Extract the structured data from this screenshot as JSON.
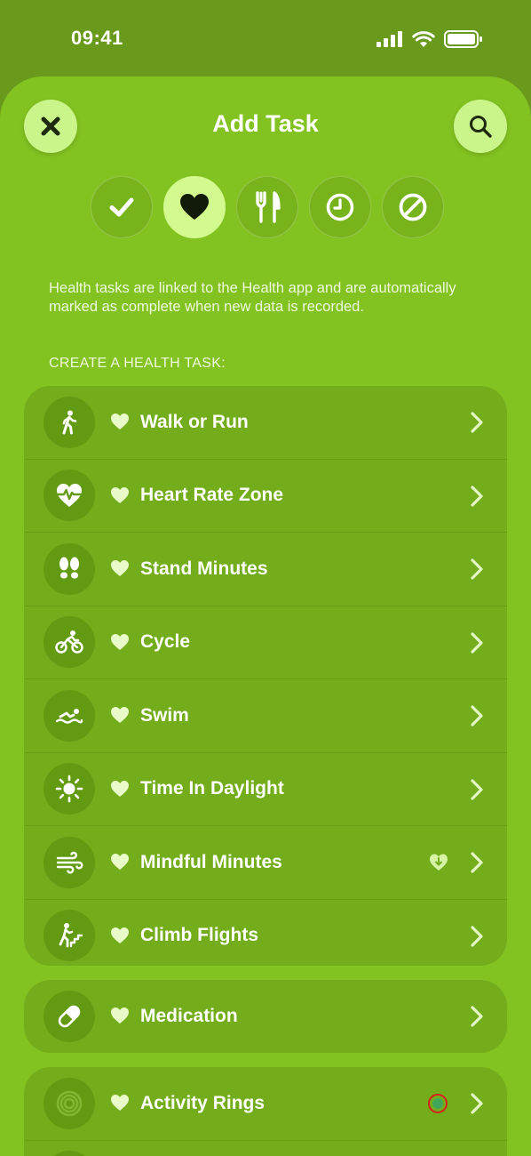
{
  "status_bar": {
    "time": "09:41"
  },
  "header": {
    "title": "Add Task"
  },
  "categories": [
    {
      "name": "checkmark-icon",
      "selected": false
    },
    {
      "name": "heart-icon",
      "selected": true
    },
    {
      "name": "fork-knife-icon",
      "selected": false
    },
    {
      "name": "clock-icon",
      "selected": false
    },
    {
      "name": "prohibited-icon",
      "selected": false
    }
  ],
  "info_text": "Health tasks are linked to the Health app and are automatically marked as complete when new data is recorded.",
  "section_header": "CREATE A HEALTH TASK:",
  "health_tasks": [
    {
      "label": "Walk or Run",
      "icon": "walking-figure-icon"
    },
    {
      "label": "Heart Rate Zone",
      "icon": "heart-rate-icon"
    },
    {
      "label": "Stand Minutes",
      "icon": "footprints-icon"
    },
    {
      "label": "Cycle",
      "icon": "bicycle-icon"
    },
    {
      "label": "Swim",
      "icon": "swimmer-icon"
    },
    {
      "label": "Time In Daylight",
      "icon": "sun-icon"
    },
    {
      "label": "Mindful Minutes",
      "icon": "wind-icon",
      "extra_icon": "heart-download-icon"
    },
    {
      "label": "Climb Flights",
      "icon": "stairs-climber-icon"
    }
  ],
  "medication": {
    "label": "Medication",
    "icon": "pill-icon"
  },
  "activity": {
    "label": "Activity Rings",
    "icon": "activity-rings-icon",
    "extra_icon": "status-dot-icon"
  },
  "colors": {
    "sheet": "#83c321",
    "group": "#73ad1c",
    "accent": "#d3fa8e",
    "status_dot_ring": "#d6201e",
    "status_dot_fill": "#3fa65a"
  }
}
